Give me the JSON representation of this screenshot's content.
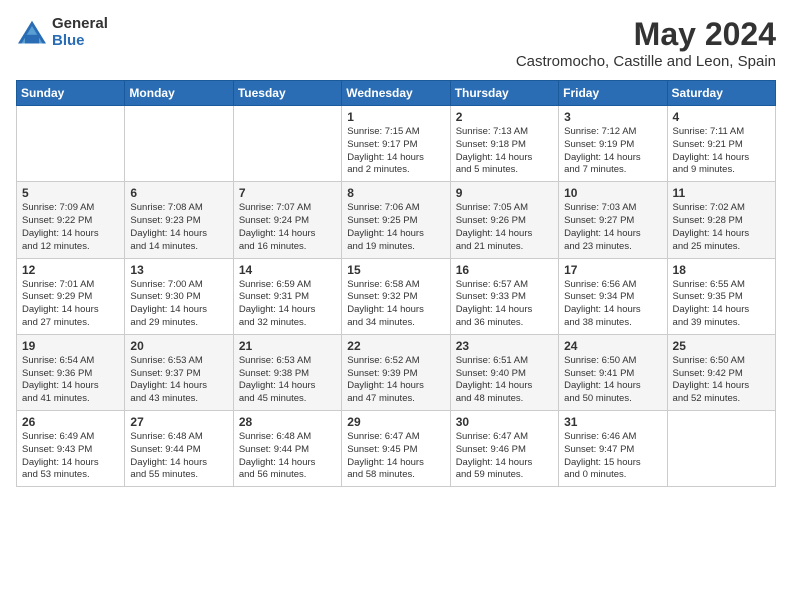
{
  "header": {
    "logo_general": "General",
    "logo_blue": "Blue",
    "month_title": "May 2024",
    "location": "Castromocho, Castille and Leon, Spain"
  },
  "days_of_week": [
    "Sunday",
    "Monday",
    "Tuesday",
    "Wednesday",
    "Thursday",
    "Friday",
    "Saturday"
  ],
  "weeks": [
    [
      {
        "day": "",
        "info": ""
      },
      {
        "day": "",
        "info": ""
      },
      {
        "day": "",
        "info": ""
      },
      {
        "day": "1",
        "info": "Sunrise: 7:15 AM\nSunset: 9:17 PM\nDaylight: 14 hours\nand 2 minutes."
      },
      {
        "day": "2",
        "info": "Sunrise: 7:13 AM\nSunset: 9:18 PM\nDaylight: 14 hours\nand 5 minutes."
      },
      {
        "day": "3",
        "info": "Sunrise: 7:12 AM\nSunset: 9:19 PM\nDaylight: 14 hours\nand 7 minutes."
      },
      {
        "day": "4",
        "info": "Sunrise: 7:11 AM\nSunset: 9:21 PM\nDaylight: 14 hours\nand 9 minutes."
      }
    ],
    [
      {
        "day": "5",
        "info": "Sunrise: 7:09 AM\nSunset: 9:22 PM\nDaylight: 14 hours\nand 12 minutes."
      },
      {
        "day": "6",
        "info": "Sunrise: 7:08 AM\nSunset: 9:23 PM\nDaylight: 14 hours\nand 14 minutes."
      },
      {
        "day": "7",
        "info": "Sunrise: 7:07 AM\nSunset: 9:24 PM\nDaylight: 14 hours\nand 16 minutes."
      },
      {
        "day": "8",
        "info": "Sunrise: 7:06 AM\nSunset: 9:25 PM\nDaylight: 14 hours\nand 19 minutes."
      },
      {
        "day": "9",
        "info": "Sunrise: 7:05 AM\nSunset: 9:26 PM\nDaylight: 14 hours\nand 21 minutes."
      },
      {
        "day": "10",
        "info": "Sunrise: 7:03 AM\nSunset: 9:27 PM\nDaylight: 14 hours\nand 23 minutes."
      },
      {
        "day": "11",
        "info": "Sunrise: 7:02 AM\nSunset: 9:28 PM\nDaylight: 14 hours\nand 25 minutes."
      }
    ],
    [
      {
        "day": "12",
        "info": "Sunrise: 7:01 AM\nSunset: 9:29 PM\nDaylight: 14 hours\nand 27 minutes."
      },
      {
        "day": "13",
        "info": "Sunrise: 7:00 AM\nSunset: 9:30 PM\nDaylight: 14 hours\nand 29 minutes."
      },
      {
        "day": "14",
        "info": "Sunrise: 6:59 AM\nSunset: 9:31 PM\nDaylight: 14 hours\nand 32 minutes."
      },
      {
        "day": "15",
        "info": "Sunrise: 6:58 AM\nSunset: 9:32 PM\nDaylight: 14 hours\nand 34 minutes."
      },
      {
        "day": "16",
        "info": "Sunrise: 6:57 AM\nSunset: 9:33 PM\nDaylight: 14 hours\nand 36 minutes."
      },
      {
        "day": "17",
        "info": "Sunrise: 6:56 AM\nSunset: 9:34 PM\nDaylight: 14 hours\nand 38 minutes."
      },
      {
        "day": "18",
        "info": "Sunrise: 6:55 AM\nSunset: 9:35 PM\nDaylight: 14 hours\nand 39 minutes."
      }
    ],
    [
      {
        "day": "19",
        "info": "Sunrise: 6:54 AM\nSunset: 9:36 PM\nDaylight: 14 hours\nand 41 minutes."
      },
      {
        "day": "20",
        "info": "Sunrise: 6:53 AM\nSunset: 9:37 PM\nDaylight: 14 hours\nand 43 minutes."
      },
      {
        "day": "21",
        "info": "Sunrise: 6:53 AM\nSunset: 9:38 PM\nDaylight: 14 hours\nand 45 minutes."
      },
      {
        "day": "22",
        "info": "Sunrise: 6:52 AM\nSunset: 9:39 PM\nDaylight: 14 hours\nand 47 minutes."
      },
      {
        "day": "23",
        "info": "Sunrise: 6:51 AM\nSunset: 9:40 PM\nDaylight: 14 hours\nand 48 minutes."
      },
      {
        "day": "24",
        "info": "Sunrise: 6:50 AM\nSunset: 9:41 PM\nDaylight: 14 hours\nand 50 minutes."
      },
      {
        "day": "25",
        "info": "Sunrise: 6:50 AM\nSunset: 9:42 PM\nDaylight: 14 hours\nand 52 minutes."
      }
    ],
    [
      {
        "day": "26",
        "info": "Sunrise: 6:49 AM\nSunset: 9:43 PM\nDaylight: 14 hours\nand 53 minutes."
      },
      {
        "day": "27",
        "info": "Sunrise: 6:48 AM\nSunset: 9:44 PM\nDaylight: 14 hours\nand 55 minutes."
      },
      {
        "day": "28",
        "info": "Sunrise: 6:48 AM\nSunset: 9:44 PM\nDaylight: 14 hours\nand 56 minutes."
      },
      {
        "day": "29",
        "info": "Sunrise: 6:47 AM\nSunset: 9:45 PM\nDaylight: 14 hours\nand 58 minutes."
      },
      {
        "day": "30",
        "info": "Sunrise: 6:47 AM\nSunset: 9:46 PM\nDaylight: 14 hours\nand 59 minutes."
      },
      {
        "day": "31",
        "info": "Sunrise: 6:46 AM\nSunset: 9:47 PM\nDaylight: 15 hours\nand 0 minutes."
      },
      {
        "day": "",
        "info": ""
      }
    ]
  ]
}
